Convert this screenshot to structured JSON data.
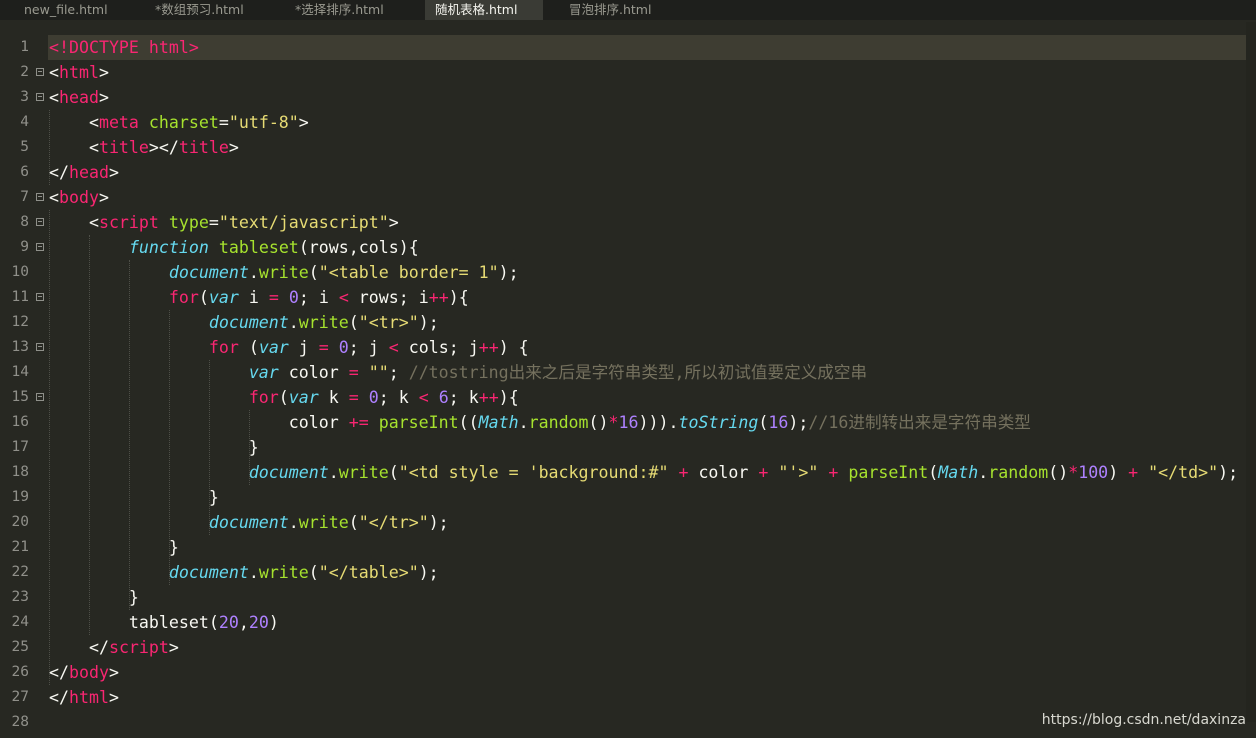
{
  "tabs": [
    {
      "label": "new_file.html",
      "active": false
    },
    {
      "label": "*数组预习.html",
      "active": false
    },
    {
      "label": "*选择排序.html",
      "active": false
    },
    {
      "label": "随机表格.html",
      "active": true
    },
    {
      "label": "冒泡排序.html",
      "active": false
    }
  ],
  "editor": {
    "current_line": 1,
    "lines": [
      {
        "n": "1",
        "fold": false,
        "tokens": [
          [
            "t-tag",
            "<!DOCTYPE html>"
          ]
        ]
      },
      {
        "n": "2",
        "fold": true,
        "tokens": [
          [
            "t-plain",
            "<"
          ],
          [
            "t-tag",
            "html"
          ],
          [
            "t-plain",
            ">"
          ]
        ]
      },
      {
        "n": "3",
        "fold": true,
        "tokens": [
          [
            "t-plain",
            "<"
          ],
          [
            "t-tag",
            "head"
          ],
          [
            "t-plain",
            ">"
          ]
        ]
      },
      {
        "n": "4",
        "fold": false,
        "tokens": [
          [
            "t-plain",
            "    <"
          ],
          [
            "t-tag",
            "meta"
          ],
          [
            "t-plain",
            " "
          ],
          [
            "t-attr",
            "charset"
          ],
          [
            "t-plain",
            "="
          ],
          [
            "t-str",
            "\"utf-8\""
          ],
          [
            "t-plain",
            ">"
          ]
        ]
      },
      {
        "n": "5",
        "fold": false,
        "tokens": [
          [
            "t-plain",
            "    <"
          ],
          [
            "t-tag",
            "title"
          ],
          [
            "t-plain",
            "></"
          ],
          [
            "t-tag",
            "title"
          ],
          [
            "t-plain",
            ">"
          ]
        ]
      },
      {
        "n": "6",
        "fold": false,
        "tokens": [
          [
            "t-plain",
            "</"
          ],
          [
            "t-tag",
            "head"
          ],
          [
            "t-plain",
            ">"
          ]
        ]
      },
      {
        "n": "7",
        "fold": true,
        "tokens": [
          [
            "t-plain",
            "<"
          ],
          [
            "t-tag",
            "body"
          ],
          [
            "t-plain",
            ">"
          ]
        ]
      },
      {
        "n": "8",
        "fold": true,
        "tokens": [
          [
            "t-plain",
            "    <"
          ],
          [
            "t-tag",
            "script"
          ],
          [
            "t-plain",
            " "
          ],
          [
            "t-attr",
            "type"
          ],
          [
            "t-plain",
            "="
          ],
          [
            "t-str",
            "\"text/javascript\""
          ],
          [
            "t-plain",
            ">"
          ]
        ]
      },
      {
        "n": "9",
        "fold": true,
        "tokens": [
          [
            "t-plain",
            "        "
          ],
          [
            "t-store",
            "function"
          ],
          [
            "t-plain",
            " "
          ],
          [
            "t-func",
            "tableset"
          ],
          [
            "t-plain",
            "(rows,cols){"
          ]
        ]
      },
      {
        "n": "10",
        "fold": false,
        "tokens": [
          [
            "t-plain",
            "            "
          ],
          [
            "t-store",
            "document"
          ],
          [
            "t-plain",
            "."
          ],
          [
            "t-func",
            "write"
          ],
          [
            "t-plain",
            "("
          ],
          [
            "t-str",
            "\"<table border= 1\""
          ],
          [
            "t-plain",
            ");"
          ]
        ]
      },
      {
        "n": "11",
        "fold": true,
        "tokens": [
          [
            "t-plain",
            "            "
          ],
          [
            "t-kw",
            "for"
          ],
          [
            "t-plain",
            "("
          ],
          [
            "t-store",
            "var"
          ],
          [
            "t-plain",
            " i "
          ],
          [
            "t-kw",
            "="
          ],
          [
            "t-plain",
            " "
          ],
          [
            "t-num",
            "0"
          ],
          [
            "t-plain",
            "; i "
          ],
          [
            "t-kw",
            "<"
          ],
          [
            "t-plain",
            " rows; i"
          ],
          [
            "t-kw",
            "++"
          ],
          [
            "t-plain",
            "){"
          ]
        ]
      },
      {
        "n": "12",
        "fold": false,
        "tokens": [
          [
            "t-plain",
            "                "
          ],
          [
            "t-store",
            "document"
          ],
          [
            "t-plain",
            "."
          ],
          [
            "t-func",
            "write"
          ],
          [
            "t-plain",
            "("
          ],
          [
            "t-str",
            "\"<tr>\""
          ],
          [
            "t-plain",
            ");"
          ]
        ]
      },
      {
        "n": "13",
        "fold": true,
        "tokens": [
          [
            "t-plain",
            "                "
          ],
          [
            "t-kw",
            "for"
          ],
          [
            "t-plain",
            " ("
          ],
          [
            "t-store",
            "var"
          ],
          [
            "t-plain",
            " j "
          ],
          [
            "t-kw",
            "="
          ],
          [
            "t-plain",
            " "
          ],
          [
            "t-num",
            "0"
          ],
          [
            "t-plain",
            "; j "
          ],
          [
            "t-kw",
            "<"
          ],
          [
            "t-plain",
            " cols; j"
          ],
          [
            "t-kw",
            "++"
          ],
          [
            "t-plain",
            ") {"
          ]
        ]
      },
      {
        "n": "14",
        "fold": false,
        "tokens": [
          [
            "t-plain",
            "                    "
          ],
          [
            "t-store",
            "var"
          ],
          [
            "t-plain",
            " color "
          ],
          [
            "t-kw",
            "="
          ],
          [
            "t-plain",
            " "
          ],
          [
            "t-str",
            "\"\""
          ],
          [
            "t-plain",
            "; "
          ],
          [
            "t-cmt",
            "//tostring出来之后是字符串类型,所以初试值要定义成空串"
          ]
        ]
      },
      {
        "n": "15",
        "fold": true,
        "tokens": [
          [
            "t-plain",
            "                    "
          ],
          [
            "t-kw",
            "for"
          ],
          [
            "t-plain",
            "("
          ],
          [
            "t-store",
            "var"
          ],
          [
            "t-plain",
            " k "
          ],
          [
            "t-kw",
            "="
          ],
          [
            "t-plain",
            " "
          ],
          [
            "t-num",
            "0"
          ],
          [
            "t-plain",
            "; k "
          ],
          [
            "t-kw",
            "<"
          ],
          [
            "t-plain",
            " "
          ],
          [
            "t-num",
            "6"
          ],
          [
            "t-plain",
            "; k"
          ],
          [
            "t-kw",
            "++"
          ],
          [
            "t-plain",
            "){"
          ]
        ]
      },
      {
        "n": "16",
        "fold": false,
        "tokens": [
          [
            "t-plain",
            "                        color "
          ],
          [
            "t-kw",
            "+="
          ],
          [
            "t-plain",
            " "
          ],
          [
            "t-func",
            "parseInt"
          ],
          [
            "t-plain",
            "(("
          ],
          [
            "t-store",
            "Math"
          ],
          [
            "t-plain",
            "."
          ],
          [
            "t-func",
            "random"
          ],
          [
            "t-plain",
            "()"
          ],
          [
            "t-kw",
            "*"
          ],
          [
            "t-num",
            "16"
          ],
          [
            "t-plain",
            ")))."
          ],
          [
            "t-store",
            "toString"
          ],
          [
            "t-plain",
            "("
          ],
          [
            "t-num",
            "16"
          ],
          [
            "t-plain",
            ");"
          ],
          [
            "t-cmt",
            "//16进制转出来是字符串类型"
          ]
        ]
      },
      {
        "n": "17",
        "fold": false,
        "tokens": [
          [
            "t-plain",
            "                    }"
          ]
        ]
      },
      {
        "n": "18",
        "fold": false,
        "tokens": [
          [
            "t-plain",
            "                    "
          ],
          [
            "t-store",
            "document"
          ],
          [
            "t-plain",
            "."
          ],
          [
            "t-func",
            "write"
          ],
          [
            "t-plain",
            "("
          ],
          [
            "t-str",
            "\"<td style = 'background:#\""
          ],
          [
            "t-plain",
            " "
          ],
          [
            "t-kw",
            "+"
          ],
          [
            "t-plain",
            " color "
          ],
          [
            "t-kw",
            "+"
          ],
          [
            "t-plain",
            " "
          ],
          [
            "t-str",
            "\"'>\""
          ],
          [
            "t-plain",
            " "
          ],
          [
            "t-kw",
            "+"
          ],
          [
            "t-plain",
            " "
          ],
          [
            "t-func",
            "parseInt"
          ],
          [
            "t-plain",
            "("
          ],
          [
            "t-store",
            "Math"
          ],
          [
            "t-plain",
            "."
          ],
          [
            "t-func",
            "random"
          ],
          [
            "t-plain",
            "()"
          ],
          [
            "t-kw",
            "*"
          ],
          [
            "t-num",
            "100"
          ],
          [
            "t-plain",
            ") "
          ],
          [
            "t-kw",
            "+"
          ],
          [
            "t-plain",
            " "
          ],
          [
            "t-str",
            "\"</td>\""
          ],
          [
            "t-plain",
            ");"
          ]
        ]
      },
      {
        "n": "19",
        "fold": false,
        "tokens": [
          [
            "t-plain",
            "                }"
          ]
        ]
      },
      {
        "n": "20",
        "fold": false,
        "tokens": [
          [
            "t-plain",
            "                "
          ],
          [
            "t-store",
            "document"
          ],
          [
            "t-plain",
            "."
          ],
          [
            "t-func",
            "write"
          ],
          [
            "t-plain",
            "("
          ],
          [
            "t-str",
            "\"</tr>\""
          ],
          [
            "t-plain",
            ");"
          ]
        ]
      },
      {
        "n": "21",
        "fold": false,
        "tokens": [
          [
            "t-plain",
            "            }"
          ]
        ]
      },
      {
        "n": "22",
        "fold": false,
        "tokens": [
          [
            "t-plain",
            "            "
          ],
          [
            "t-store",
            "document"
          ],
          [
            "t-plain",
            "."
          ],
          [
            "t-func",
            "write"
          ],
          [
            "t-plain",
            "("
          ],
          [
            "t-str",
            "\"</table>\""
          ],
          [
            "t-plain",
            ");"
          ]
        ]
      },
      {
        "n": "23",
        "fold": false,
        "tokens": [
          [
            "t-plain",
            "        }"
          ]
        ]
      },
      {
        "n": "24",
        "fold": false,
        "tokens": [
          [
            "t-plain",
            "        tableset("
          ],
          [
            "t-num",
            "20"
          ],
          [
            "t-plain",
            ","
          ],
          [
            "t-num",
            "20"
          ],
          [
            "t-plain",
            ")"
          ]
        ]
      },
      {
        "n": "25",
        "fold": false,
        "tokens": [
          [
            "t-plain",
            "    </"
          ],
          [
            "t-tag",
            "script"
          ],
          [
            "t-plain",
            ">"
          ]
        ]
      },
      {
        "n": "26",
        "fold": false,
        "tokens": [
          [
            "t-plain",
            "</"
          ],
          [
            "t-tag",
            "body"
          ],
          [
            "t-plain",
            ">"
          ]
        ]
      },
      {
        "n": "27",
        "fold": false,
        "tokens": [
          [
            "t-plain",
            "</"
          ],
          [
            "t-tag",
            "html"
          ],
          [
            "t-plain",
            ">"
          ]
        ]
      },
      {
        "n": "28",
        "fold": false,
        "tokens": []
      }
    ]
  },
  "watermark": "https://blog.csdn.net/daxinza"
}
